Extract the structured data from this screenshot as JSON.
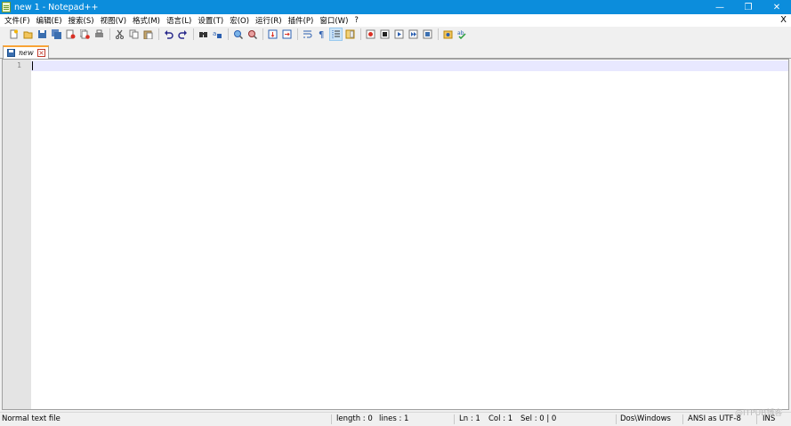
{
  "window": {
    "title": "new  1 - Notepad++",
    "minimize_glyph": "—",
    "restore_glyph": "❐",
    "close_glyph": "✕"
  },
  "menu": {
    "items": [
      {
        "label": "文件(F)"
      },
      {
        "label": "编辑(E)"
      },
      {
        "label": "搜索(S)"
      },
      {
        "label": "视图(V)"
      },
      {
        "label": "格式(M)"
      },
      {
        "label": "语言(L)"
      },
      {
        "label": "设置(T)"
      },
      {
        "label": "宏(O)"
      },
      {
        "label": "运行(R)"
      },
      {
        "label": "插件(P)"
      },
      {
        "label": "窗口(W)"
      },
      {
        "label": "?"
      }
    ],
    "close_glyph": "X"
  },
  "toolbar": {
    "groups": [
      [
        "new-file-icon",
        "open-file-icon",
        "save-icon",
        "save-all-icon",
        "close-file-icon",
        "close-all-icon",
        "print-icon"
      ],
      [
        "cut-icon",
        "copy-icon",
        "paste-icon"
      ],
      [
        "undo-icon",
        "redo-icon"
      ],
      [
        "find-icon",
        "replace-icon"
      ],
      [
        "zoom-in-icon",
        "zoom-out-icon"
      ],
      [
        "sync-vertical-icon",
        "sync-horizontal-icon"
      ],
      [
        "word-wrap-icon",
        "show-all-characters-icon",
        "indent-guide-icon",
        "document-map-icon"
      ],
      [
        "record-macro-icon",
        "stop-recording-icon",
        "playback-macro-icon",
        "run-macro-multiple-icon",
        "save-macro-icon"
      ],
      [
        "launch-browser-icon",
        "spell-check-icon"
      ]
    ],
    "active": "indent-guide-icon"
  },
  "tabs": [
    {
      "label": "new",
      "close_glyph": "×"
    }
  ],
  "editor": {
    "line_numbers": [
      "1"
    ],
    "content": ""
  },
  "status": {
    "file_type": "Normal text file",
    "length": "length : 0",
    "lines": "lines : 1",
    "ln": "Ln : 1",
    "col": "Col : 1",
    "sel": "Sel : 0 | 0",
    "eol": "Dos\\Windows",
    "encoding": "ANSI as UTF-8",
    "mode": "INS"
  },
  "watermark": "@ITPUB博客"
}
